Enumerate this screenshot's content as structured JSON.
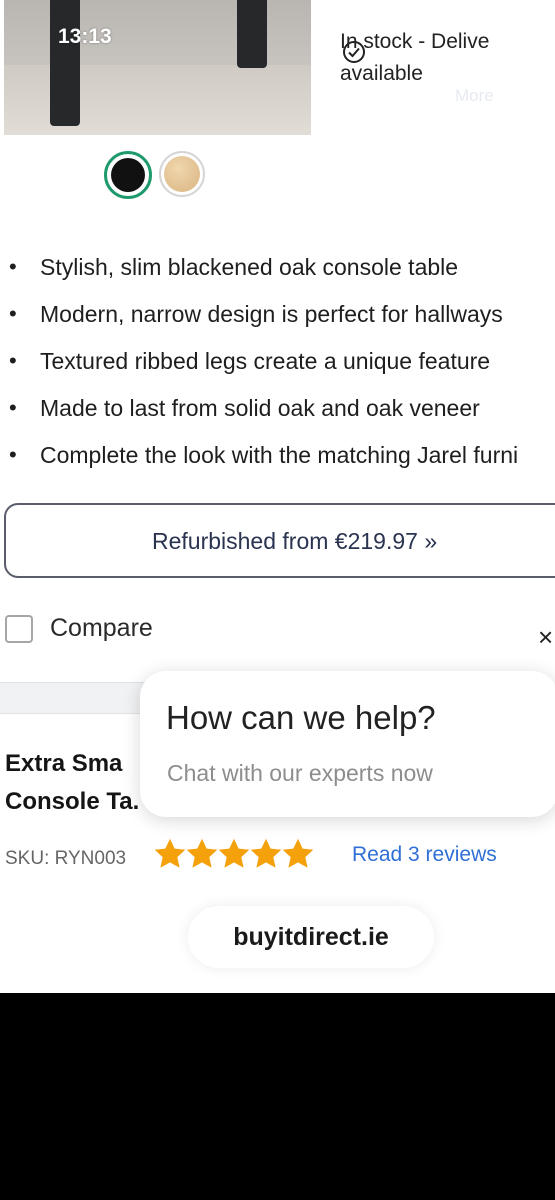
{
  "status_bar": {
    "time": "13:13"
  },
  "availability": {
    "line1": "In stock - Delive",
    "line2": "available",
    "ghost_text": "More"
  },
  "color_options": [
    {
      "name": "black",
      "color": "#111111",
      "selected": true,
      "ring_color": "#1f9a6d"
    },
    {
      "name": "oak",
      "color": "#e2c08f",
      "selected": false
    }
  ],
  "features": [
    "Stylish, slim blackened oak console table",
    "Modern, narrow design is perfect for hallways",
    "Textured ribbed legs create a unique feature",
    "Made to last from solid oak and oak veneer",
    "Complete the look with the matching Jarel furni"
  ],
  "refurbished_button": {
    "label": "Refurbished from €219.97 »"
  },
  "compare": {
    "label": "Compare",
    "checked": false,
    "close_symbol": "×"
  },
  "product": {
    "title_line1": "Extra Sma",
    "title_line2": "Console Ta.",
    "sku": "SKU: RYN003"
  },
  "rating": {
    "stars": 5,
    "max": 5,
    "reviews_link": "Read 3 reviews",
    "star_color": "#f5a10b"
  },
  "chat_popup": {
    "heading": "How can we help?",
    "subtext": "Chat with our experts now"
  },
  "site_badge": {
    "domain": "buyitdirect.ie"
  }
}
